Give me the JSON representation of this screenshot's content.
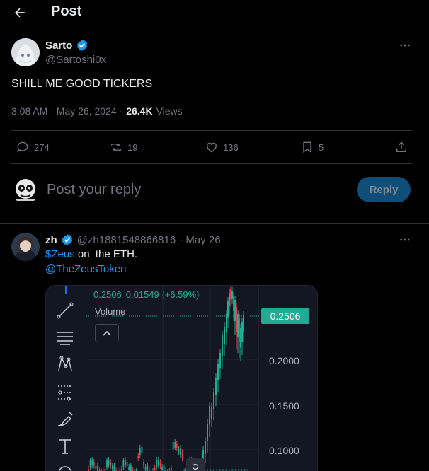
{
  "header": {
    "title": "Post"
  },
  "post": {
    "author_name": "Sarto",
    "author_handle": "@Sartoshi0x",
    "text": "SHILL ME GOOD TICKERS",
    "time": "3:08 AM · May 26, 2024 ·",
    "views_count": "26.4K",
    "views_label": "Views",
    "replies": "274",
    "reposts": "19",
    "likes": "136",
    "bookmarks": "5"
  },
  "composer": {
    "placeholder": "Post your reply",
    "reply_label": "Reply"
  },
  "reply": {
    "author_name": "zh",
    "author_handle": "@zh1881548866816",
    "sep_date": "· May 26",
    "cashtag": "$Zeus",
    "text_rest": " on  the ETH.",
    "mention": "@TheZeusToken"
  },
  "chart_data": {
    "type": "candlestick",
    "header_price": "0.2506",
    "header_change": "0.01549 (+6.59%)",
    "indicator_label": "Volume",
    "last_price_label": "0.2506",
    "y_ticks": [
      "0.2000",
      "0.1500",
      "0.1000"
    ],
    "colors": {
      "up": "#22ab94",
      "down": "#f23645",
      "accent": "#1d9bf0"
    }
  }
}
